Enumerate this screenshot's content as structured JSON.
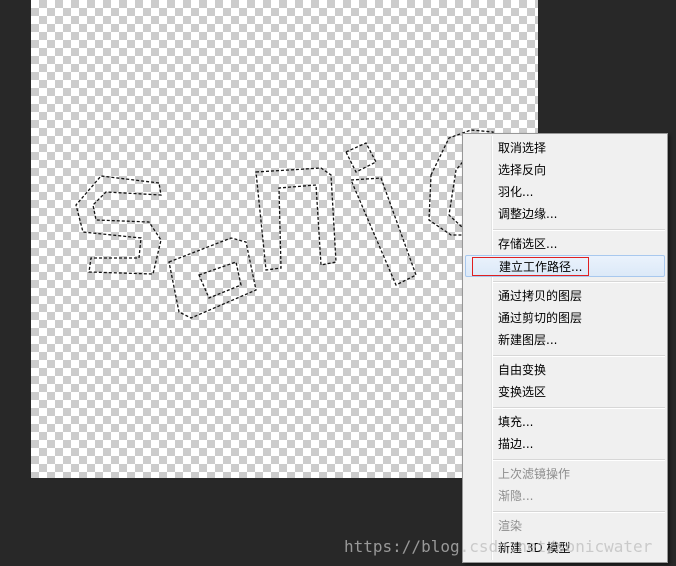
{
  "context_menu": {
    "items": [
      {
        "label": "取消选择",
        "enabled": true
      },
      {
        "label": "选择反向",
        "enabled": true
      },
      {
        "label": "羽化...",
        "enabled": true
      },
      {
        "label": "调整边缘...",
        "enabled": true
      },
      {
        "label": "存储选区...",
        "enabled": true
      },
      {
        "label": "建立工作路径...",
        "enabled": true,
        "hovered": true
      },
      {
        "label": "通过拷贝的图层",
        "enabled": true
      },
      {
        "label": "通过剪切的图层",
        "enabled": true
      },
      {
        "label": "新建图层...",
        "enabled": true
      },
      {
        "label": "自由变换",
        "enabled": true
      },
      {
        "label": "变换选区",
        "enabled": true
      },
      {
        "label": "填充...",
        "enabled": true
      },
      {
        "label": "描边...",
        "enabled": true
      },
      {
        "label": "上次滤镜操作",
        "enabled": false
      },
      {
        "label": "渐隐...",
        "enabled": false
      },
      {
        "label": "渲染",
        "enabled": false
      },
      {
        "label": "新建 3D 模型",
        "enabled": true
      }
    ]
  },
  "watermark": "https://blog.csdn.net/sonicwater",
  "colors": {
    "workspace_bg": "#282828",
    "menu_bg": "#f0f0f0",
    "highlight_box": "#e02020"
  }
}
